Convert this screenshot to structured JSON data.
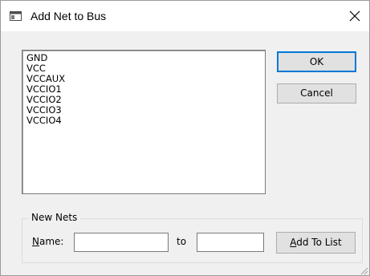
{
  "window": {
    "title": "Add Net to Bus",
    "close_icon": "close-icon"
  },
  "netlist": {
    "items": [
      "GND",
      "VCC",
      "VCCAUX",
      "VCCIO1",
      "VCCIO2",
      "VCCIO3",
      "VCCIO4"
    ]
  },
  "buttons": {
    "ok": "OK",
    "cancel": "Cancel",
    "add_to_list": "Add To List"
  },
  "new_nets": {
    "group_label": "New Nets",
    "name_label_mnemonic": "N",
    "name_label_rest": "ame:",
    "to_label": "to",
    "name_value": "",
    "to_value": ""
  },
  "colors": {
    "focus_border": "#0078d7",
    "button_face": "#e1e1e1",
    "window_bg": "#f0f0f0"
  }
}
